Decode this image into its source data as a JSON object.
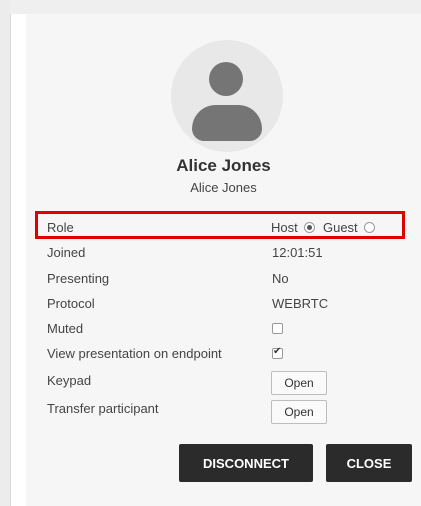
{
  "participant": {
    "display_name": "Alice Jones",
    "alias": "Alice Jones"
  },
  "details": {
    "role": {
      "label": "Role",
      "options": [
        "Host",
        "Guest"
      ],
      "selected": "Host"
    },
    "joined": {
      "label": "Joined",
      "value": "12:01:51"
    },
    "presenting": {
      "label": "Presenting",
      "value": "No"
    },
    "protocol": {
      "label": "Protocol",
      "value": "WEBRTC"
    },
    "muted": {
      "label": "Muted",
      "checked": false
    },
    "view_presentation": {
      "label": "View presentation on endpoint",
      "checked": true
    },
    "keypad": {
      "label": "Keypad",
      "button": "Open"
    },
    "transfer": {
      "label": "Transfer participant",
      "button": "Open"
    }
  },
  "actions": {
    "disconnect": "DISCONNECT",
    "close": "CLOSE"
  },
  "colors": {
    "highlight_border": "#e00000",
    "action_button_bg": "#2b2b2b"
  }
}
